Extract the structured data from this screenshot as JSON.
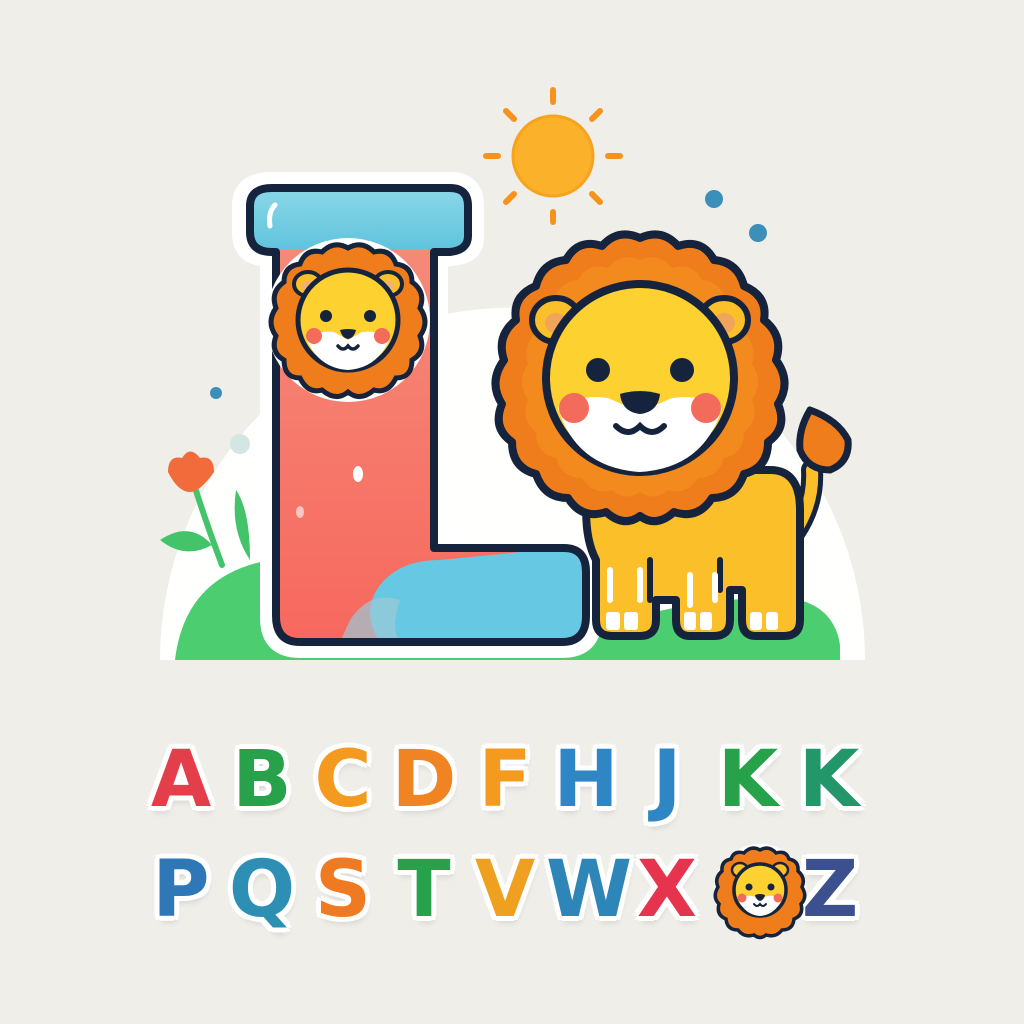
{
  "colors": {
    "background": "#efeee9",
    "halo": "#ffffff",
    "outline": "#15233d",
    "letter_top": "#72cde0",
    "letter_stem": "#f7766a",
    "letter_foot": "#67c8e3",
    "mane": "#f07d1c",
    "lion_body": "#fbbf2a",
    "lion_face": "#fdd12f",
    "cheek": "#f36b5a",
    "sun": "#fbb12a",
    "sun_rays": "#f6931d",
    "grass": "#4ccd70",
    "flower": "#f26b3a",
    "dots": "#3b8fb9"
  },
  "icons": {
    "big_letter": "letter-l-block",
    "main_lion": "lion-icon",
    "small_lion": "lion-face-icon",
    "sun": "sun-icon",
    "flower": "flower-icon"
  },
  "alphabet": {
    "row1": [
      {
        "char": "A",
        "color": "#e53e4b"
      },
      {
        "char": "B",
        "color": "#27a24a"
      },
      {
        "char": "C",
        "color": "#f39a1f"
      },
      {
        "char": "D",
        "color": "#f08322"
      },
      {
        "char": "F",
        "color": "#f39a1f"
      },
      {
        "char": "H",
        "color": "#2f86c4"
      },
      {
        "char": "J",
        "color": "#2f86c4"
      },
      {
        "char": "K",
        "color": "#27a24a"
      },
      {
        "char": "K",
        "color": "#23966a"
      }
    ],
    "row2": [
      {
        "char": "P",
        "color": "#2f78b7"
      },
      {
        "char": "Q",
        "color": "#2e8fb5"
      },
      {
        "char": "S",
        "color": "#f07a22"
      },
      {
        "char": "T",
        "color": "#27a24a"
      },
      {
        "char": "V",
        "color": "#f0a020"
      },
      {
        "char": "W",
        "color": "#2e86b8"
      },
      {
        "char": "X",
        "color": "#e6344e"
      },
      {
        "char": "Z",
        "color": "#3c4f8e"
      }
    ]
  }
}
